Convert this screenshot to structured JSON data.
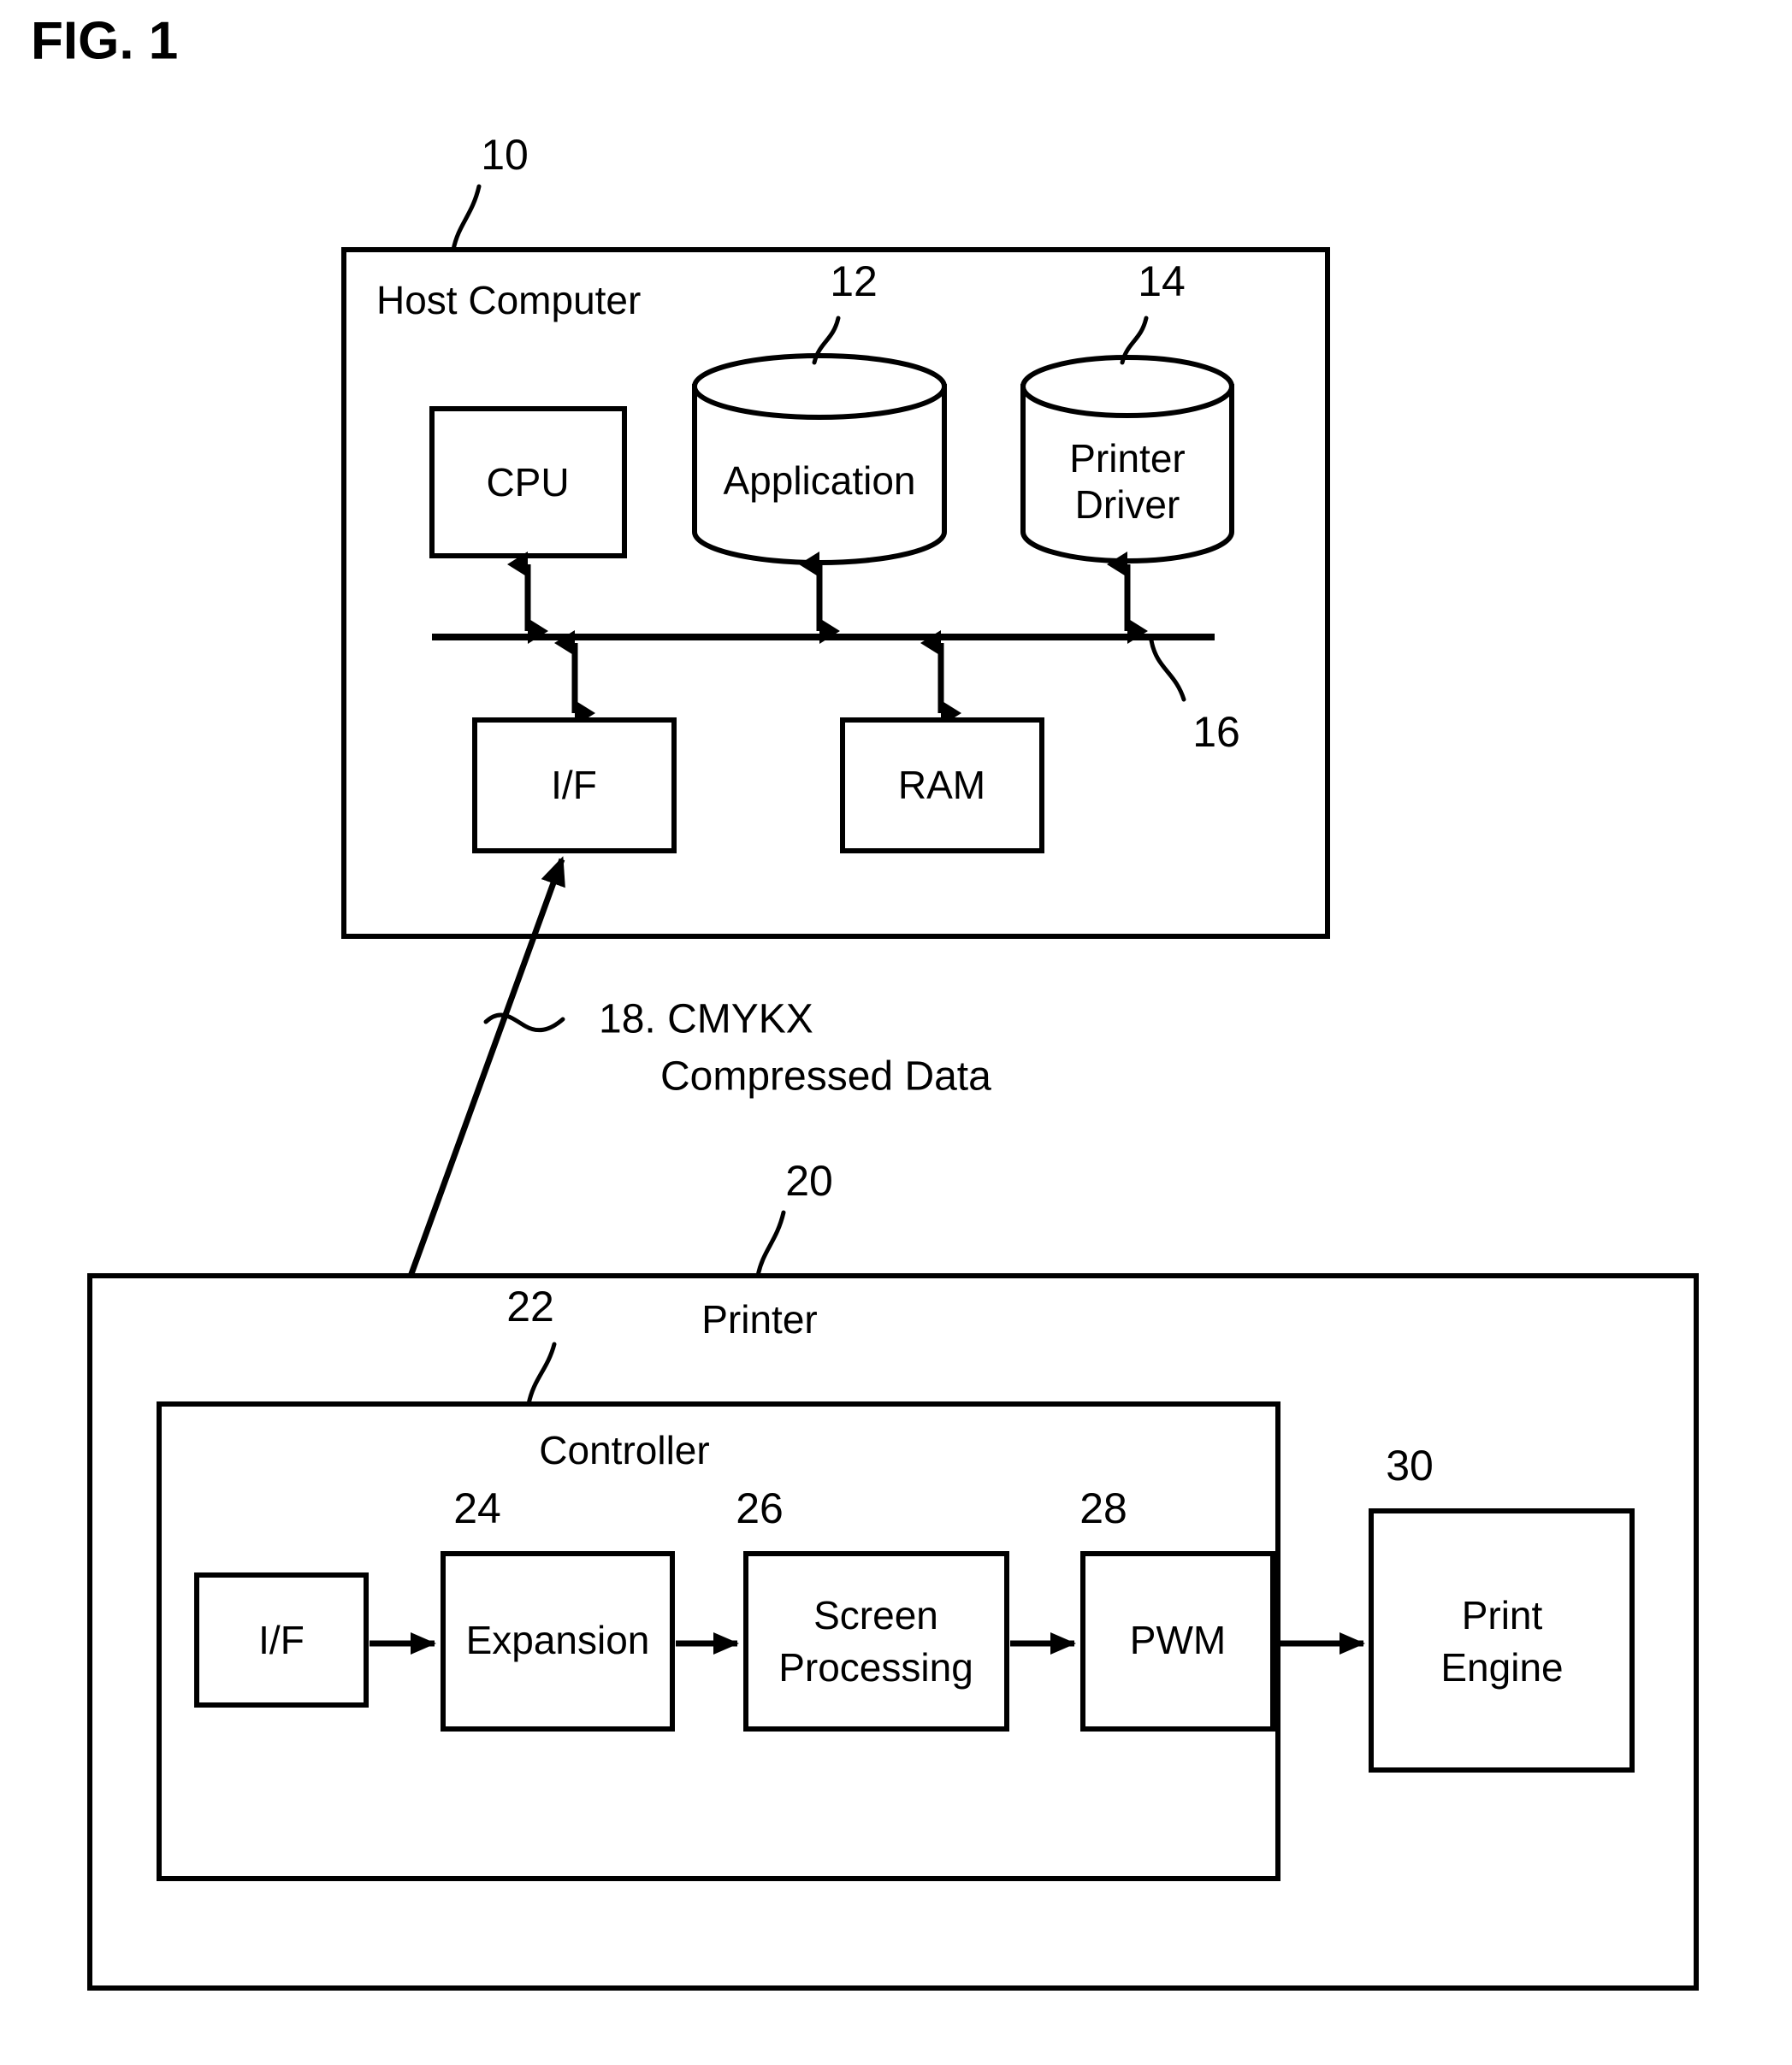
{
  "figure": {
    "title": "FIG. 1",
    "caption_items": [
      {
        "ref": "18.",
        "line1": "18. CMYKX",
        "line2": "Compressed Data"
      }
    ]
  },
  "host": {
    "ref": "10",
    "title": "Host Computer",
    "cpu": {
      "label": "CPU"
    },
    "application": {
      "ref": "12",
      "label": "Application"
    },
    "printer_driver": {
      "ref": "14",
      "label_line1": "Printer",
      "label_line2": "Driver"
    },
    "bus": {
      "ref": "16"
    },
    "interface": {
      "label": "I/F"
    },
    "ram": {
      "label": "RAM"
    }
  },
  "link": {
    "ref": "18",
    "label_line1": "18. CMYKX",
    "label_line2": "Compressed Data"
  },
  "printer": {
    "ref": "20",
    "title": "Printer",
    "controller": {
      "ref": "22",
      "title": "Controller",
      "stages": [
        {
          "ref": "",
          "label_line1": "I/F",
          "label_line2": ""
        },
        {
          "ref": "24",
          "label_line1": "Expansion",
          "label_line2": ""
        },
        {
          "ref": "26",
          "label_line1": "Screen",
          "label_line2": "Processing"
        },
        {
          "ref": "28",
          "label_line1": "PWM",
          "label_line2": ""
        }
      ]
    },
    "print_engine": {
      "ref": "30",
      "label_line1": "Print",
      "label_line2": "Engine"
    }
  },
  "colors": {
    "ink": "#000000",
    "paper": "#ffffff"
  }
}
